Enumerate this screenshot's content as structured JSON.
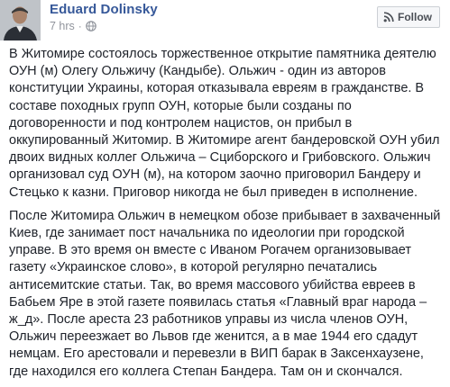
{
  "post": {
    "author": "Eduard Dolinsky",
    "timestamp": "7 hrs",
    "separator": "·",
    "follow_label": "Follow",
    "paragraphs": [
      "В Житомире состоялось торжественное открытие памятника деятелю ОУН (м) Олегу Ольжичу (Кандыбе). Ольжич - один из авторов конституции Украины, которая отказывала евреям в гражданстве. В составе походных групп ОУН, которые были созданы по договоренности и под контролем нацистов, он прибыл в оккупированный Житомир. В Житомире агент бандеровской ОУН убил двоих видных коллег Ольжича – Сциборского и Грибовского. Ольжич организовал суд ОУН (м), на котором заочно приговорил Бандеру и Стецько к казни. Приговор никогда не был приведен в исполнение.",
      "После Житомира Ольжич в немецком обозе прибывает в захваченный Киев, где занимает пост начальника по идеологии при городской управе. В это время он вместе с Иваном Рогачем организовывает газету «Украинское слово», в которой регулярно печатались антисемитские статьи. Так, во время массового убийства евреев в Бабьем Яре в этой газете появилась статья «Главный враг народа – ж_д». После ареста 23 работников управы из числа членов ОУН, Ольжич переезжает во Львов где женится, а в мае 1944 его сдадут немцам. Его арестовали и перевезли в ВИП барак в Заксенхаузене, где находился его коллега Степан Бандера. Там он и скончался."
    ],
    "icons": {
      "avatar": "profile-photo",
      "privacy": "globe-icon",
      "follow": "rss-icon"
    }
  }
}
